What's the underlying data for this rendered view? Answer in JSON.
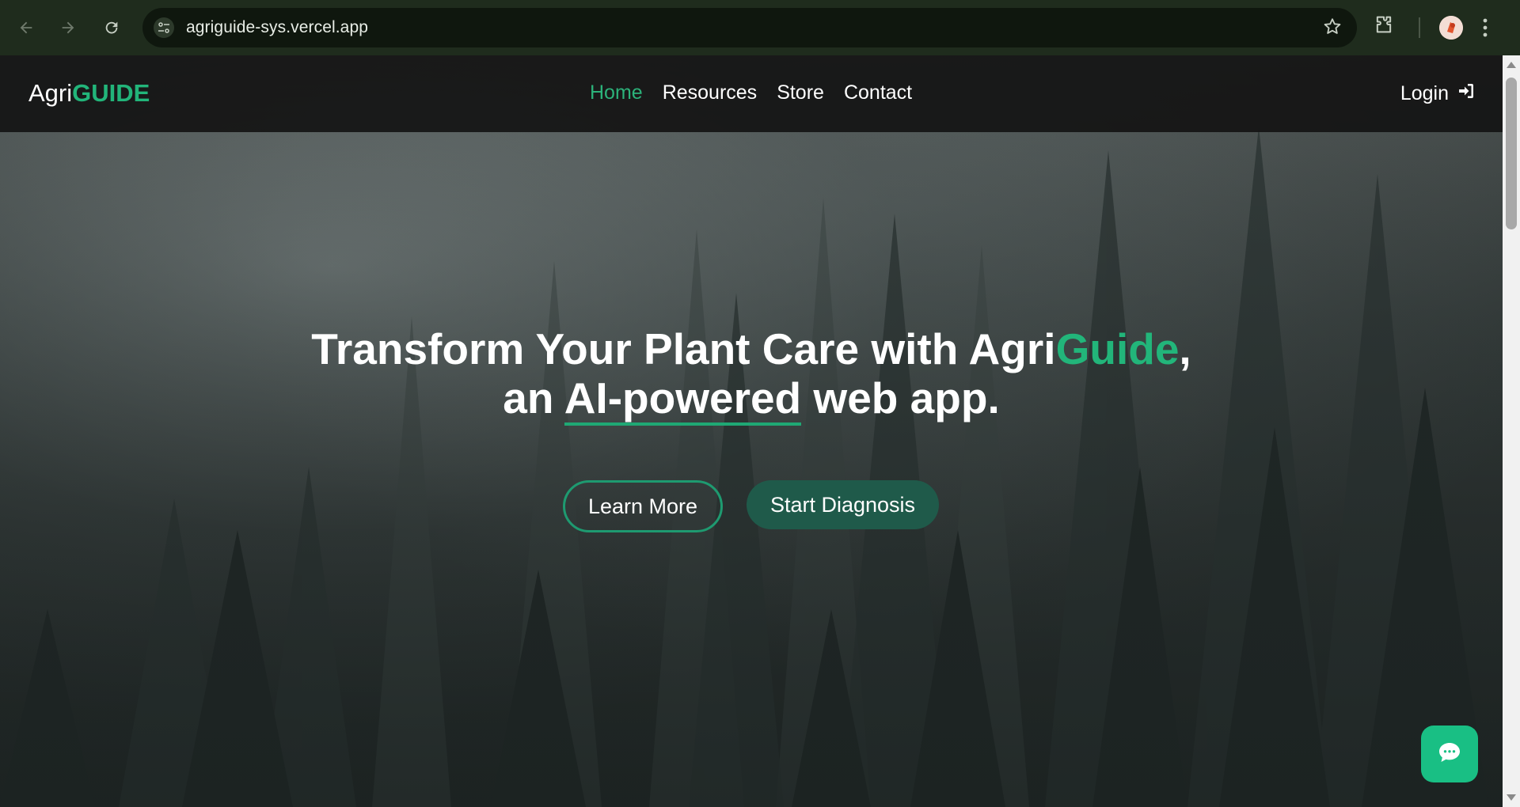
{
  "browser": {
    "url": "agriguide-sys.vercel.app",
    "icons": [
      "back-arrow-icon",
      "forward-arrow-icon",
      "reload-icon",
      "site-settings-icon",
      "bookmark-star-icon",
      "extensions-icon",
      "profile-avatar",
      "more-menu-icon"
    ]
  },
  "site": {
    "logo_prefix": "Agri",
    "logo_accent": "GUIDE",
    "nav": {
      "home": "Home",
      "resources": "Resources",
      "store": "Store",
      "contact": "Contact"
    },
    "login_label": "Login",
    "hero": {
      "line1_prefix": "Transform Your Plant Care with Agri",
      "line1_accent": "Guide",
      "line1_suffix": ",",
      "line2_prefix": "an ",
      "line2_underlined": "AI-powered",
      "line2_suffix": " web app."
    },
    "buttons": {
      "learn_more": "Learn More",
      "start_diagnosis": "Start Diagnosis"
    }
  },
  "colors": {
    "accent": "#22b57a",
    "chrome_bg": "#1f2c1d",
    "nav_bg": "#141414",
    "chat_button": "#19bf84"
  }
}
